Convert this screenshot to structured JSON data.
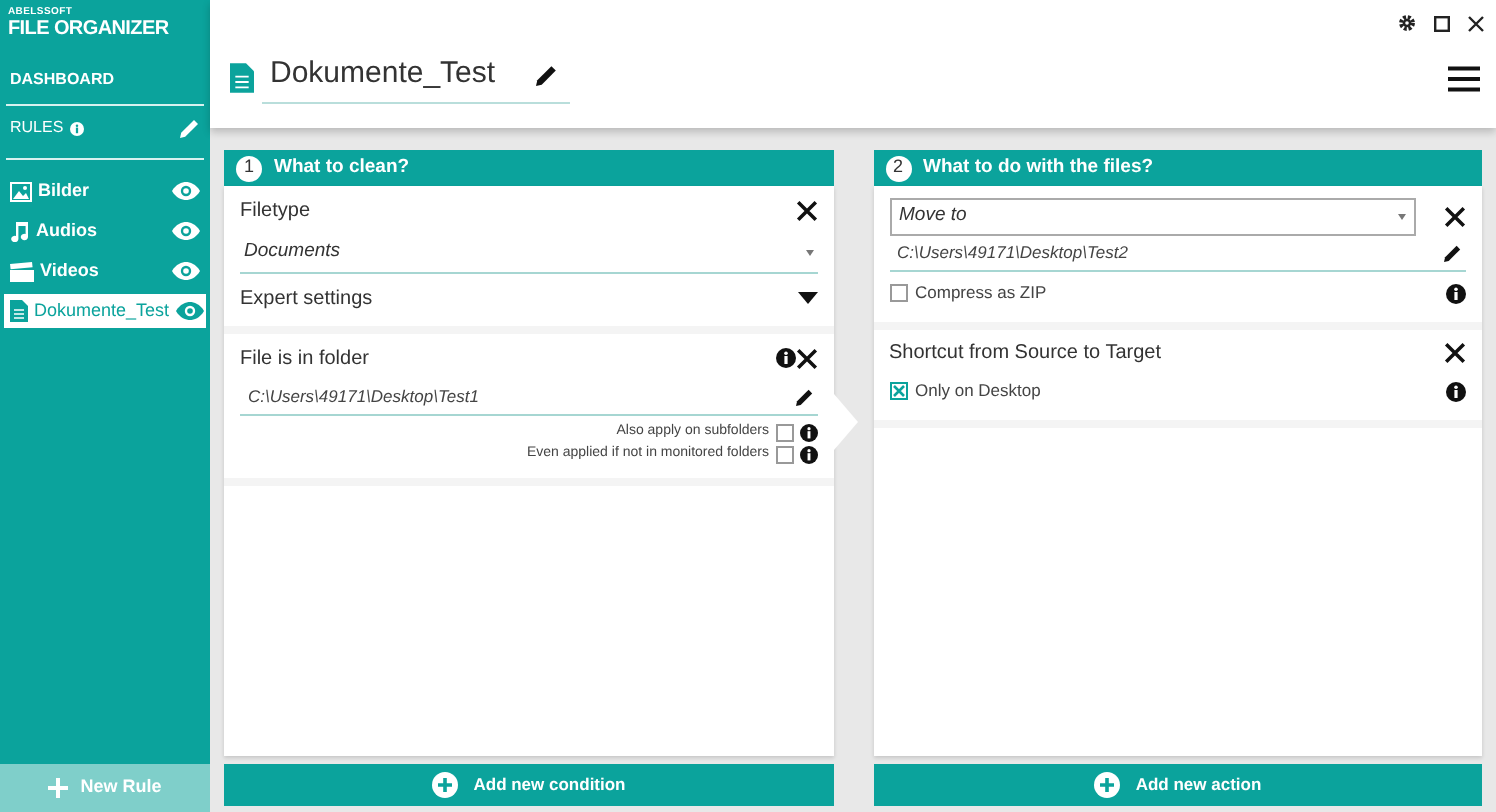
{
  "sidebar": {
    "brand_small": "ABELSSOFT",
    "brand": "FILE ORGANIZER",
    "dashboard": "DASHBOARD",
    "rules_label": "RULES",
    "items": [
      {
        "label": "Bilder",
        "kind": "image",
        "selected": false
      },
      {
        "label": "Audios",
        "kind": "music",
        "selected": false
      },
      {
        "label": "Videos",
        "kind": "video",
        "selected": false
      },
      {
        "label": "Dokumente_Test",
        "kind": "document",
        "selected": true
      }
    ],
    "new_rule": "New Rule"
  },
  "header": {
    "title": "Dokumente_Test"
  },
  "panels": [
    {
      "number": "1",
      "title": "What to clean?",
      "add_button": "Add new condition",
      "sections": [
        {
          "title": "Filetype",
          "dropdown": "Documents",
          "expander": "Expert settings"
        },
        {
          "title": "File is in folder",
          "info": true,
          "path": "C:\\Users\\49171\\Desktop\\Test1",
          "options": [
            {
              "label": "Also apply on subfolders",
              "checked": false
            },
            {
              "label": "Even applied if not in monitored folders",
              "checked": false
            }
          ]
        }
      ]
    },
    {
      "number": "2",
      "title": "What to do with the files?",
      "add_button": "Add new action",
      "sections": [
        {
          "select": "Move to",
          "path": "C:\\Users\\49171\\Desktop\\Test2",
          "checkbox": {
            "label": "Compress as ZIP",
            "checked": false
          }
        },
        {
          "title": "Shortcut from Source to Target",
          "checkbox": {
            "label": "Only on Desktop",
            "checked": true
          }
        }
      ]
    }
  ]
}
